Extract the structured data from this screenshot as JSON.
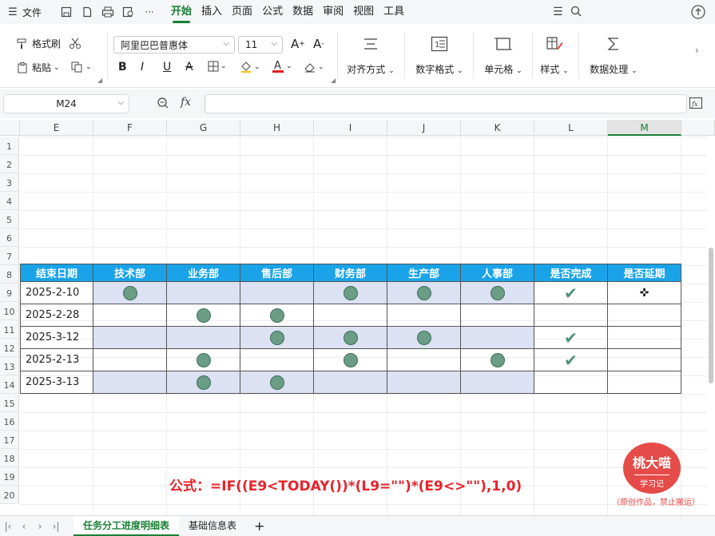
{
  "menubar": {
    "file": "文件",
    "tabs": [
      "开始",
      "插入",
      "页面",
      "公式",
      "数据",
      "审阅",
      "视图",
      "工具"
    ],
    "active_tab": 0
  },
  "ribbon": {
    "format_painter": "格式刷",
    "paste": "粘贴",
    "font_name": "阿里巴巴普惠体",
    "font_size": "11",
    "bold": "B",
    "italic": "I",
    "underline": "U",
    "strike": "A",
    "align": "对齐方式",
    "number_format": "数字格式",
    "cell": "单元格",
    "style": "样式",
    "data_processing": "数据处理"
  },
  "formula_bar": {
    "name_box": "M24",
    "fx": "fx",
    "value": ""
  },
  "grid": {
    "columns": [
      "E",
      "F",
      "G",
      "H",
      "I",
      "J",
      "K",
      "L",
      "M"
    ],
    "selected_column": "M",
    "rows": [
      "1",
      "2",
      "3",
      "4",
      "5",
      "6",
      "7",
      "8",
      "9",
      "10",
      "11",
      "12",
      "13",
      "14",
      "15",
      "16",
      "17",
      "18",
      "19",
      "20"
    ]
  },
  "table": {
    "headers": [
      "结束日期",
      "技术部",
      "业务部",
      "售后部",
      "财务部",
      "生产部",
      "人事部",
      "是否完成",
      "是否延期"
    ],
    "rows": [
      {
        "date": "2025-2-10",
        "dots": [
          true,
          false,
          false,
          true,
          true,
          true
        ],
        "done": true
      },
      {
        "date": "2025-2-28",
        "dots": [
          false,
          true,
          true,
          false,
          false,
          false
        ],
        "done": false
      },
      {
        "date": "2025-3-12",
        "dots": [
          false,
          false,
          true,
          true,
          true,
          false
        ],
        "done": true
      },
      {
        "date": "2025-2-13",
        "dots": [
          false,
          true,
          false,
          true,
          false,
          true
        ],
        "done": true
      },
      {
        "date": "2025-3-13",
        "dots": [
          false,
          true,
          true,
          false,
          false,
          false
        ],
        "done": false
      }
    ],
    "header_color": "#1aa3e8",
    "band_color": "#dce1f3",
    "dot_color": "#6a9c86",
    "check_color": "#4e9178"
  },
  "annotation": {
    "formula": "公式：=IF((E9<TODAY())*(L9=\"\")*(E9<>\"\"),1,0)",
    "formula_color": "#e8222a"
  },
  "watermark": {
    "name": "桃大喵",
    "sub": "学习记",
    "note": "（原创作品，禁止搬运）"
  },
  "sheets": {
    "tabs": [
      "任务分工进度明细表",
      "基础信息表"
    ],
    "active": 0,
    "add": "+"
  }
}
